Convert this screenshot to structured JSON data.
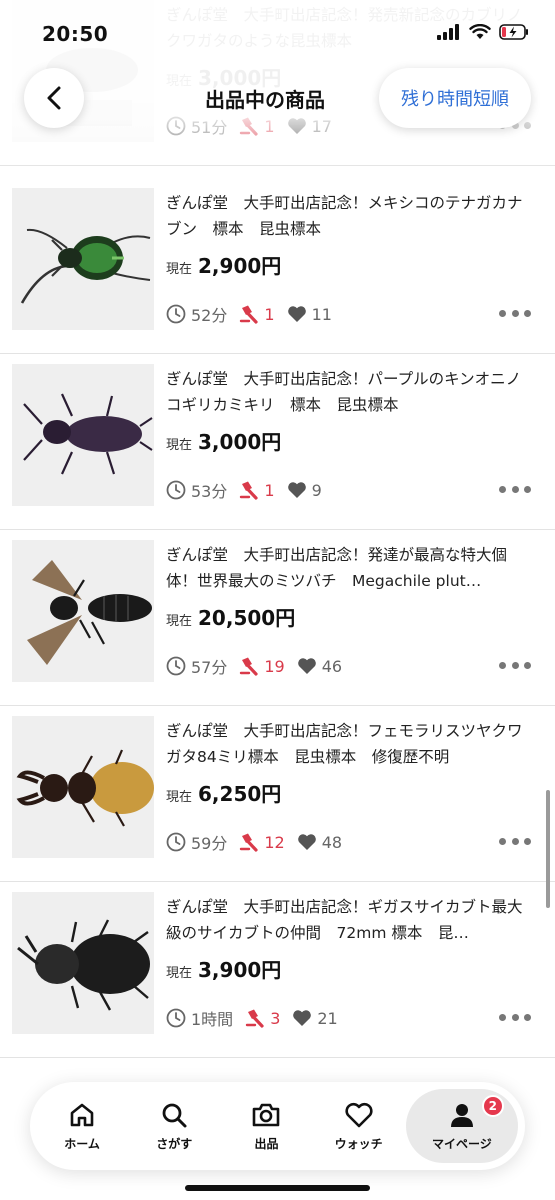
{
  "status_bar": {
    "time": "20:50"
  },
  "header": {
    "title": "出品中の商品",
    "sort_label": "残り時間短順"
  },
  "items": [
    {
      "title": "ぎんぽ堂　大手町出店記念！発売新記念のカブリノクワガタのような昆虫標本",
      "price_label": "現在",
      "price": "3,000円",
      "time_left": "51分",
      "bids": "1",
      "watchers": "17",
      "photo": "faded"
    },
    {
      "title": "ぎんぽ堂　大手町出店記念！メキシコのテナガカナブン　標本　昆虫標本",
      "price_label": "現在",
      "price": "2,900円",
      "time_left": "52分",
      "bids": "1",
      "watchers": "11",
      "photo": "green-beetle"
    },
    {
      "title": "ぎんぽ堂　大手町出店記念！パープルのキンオニノコギリカミキリ　標本　昆虫標本",
      "price_label": "現在",
      "price": "3,000円",
      "time_left": "53分",
      "bids": "1",
      "watchers": "9",
      "photo": "purple-longhorn"
    },
    {
      "title": "ぎんぽ堂　大手町出店記念！発達が最高な特大個体！世界最大のミツバチ　Megachile plut…",
      "price_label": "現在",
      "price": "20,500円",
      "time_left": "57分",
      "bids": "19",
      "watchers": "46",
      "photo": "bee"
    },
    {
      "title": "ぎんぽ堂　大手町出店記念！フェモラリスツヤクワガタ84ミリ標本　昆虫標本　修復歴不明",
      "price_label": "現在",
      "price": "6,250円",
      "time_left": "59分",
      "bids": "12",
      "watchers": "48",
      "photo": "stag-beetle"
    },
    {
      "title": "ぎんぽ堂　大手町出店記念！ギガスサイカブト最大級のサイカブトの仲間　72mm 標本　昆…",
      "price_label": "現在",
      "price": "3,900円",
      "time_left": "1時間",
      "bids": "3",
      "watchers": "21",
      "photo": "rhino-beetle"
    }
  ],
  "tabs": [
    {
      "label": "ホーム",
      "icon": "home-icon"
    },
    {
      "label": "さがす",
      "icon": "search-icon"
    },
    {
      "label": "出品",
      "icon": "camera-icon"
    },
    {
      "label": "ウォッチ",
      "icon": "heart-icon"
    },
    {
      "label": "マイページ",
      "icon": "person-icon",
      "badge": "2",
      "active": true
    }
  ],
  "colors": {
    "accent": "#2f6fd6",
    "bid": "#d93a4a",
    "badge": "#e5384d"
  }
}
